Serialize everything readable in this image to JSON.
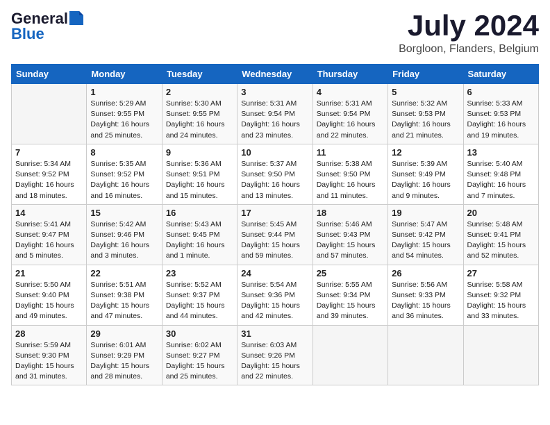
{
  "header": {
    "logo_general": "General",
    "logo_blue": "Blue",
    "title": "July 2024",
    "subtitle": "Borgloon, Flanders, Belgium"
  },
  "days_of_week": [
    "Sunday",
    "Monday",
    "Tuesday",
    "Wednesday",
    "Thursday",
    "Friday",
    "Saturday"
  ],
  "weeks": [
    [
      {
        "day": "",
        "info": ""
      },
      {
        "day": "1",
        "info": "Sunrise: 5:29 AM\nSunset: 9:55 PM\nDaylight: 16 hours\nand 25 minutes."
      },
      {
        "day": "2",
        "info": "Sunrise: 5:30 AM\nSunset: 9:55 PM\nDaylight: 16 hours\nand 24 minutes."
      },
      {
        "day": "3",
        "info": "Sunrise: 5:31 AM\nSunset: 9:54 PM\nDaylight: 16 hours\nand 23 minutes."
      },
      {
        "day": "4",
        "info": "Sunrise: 5:31 AM\nSunset: 9:54 PM\nDaylight: 16 hours\nand 22 minutes."
      },
      {
        "day": "5",
        "info": "Sunrise: 5:32 AM\nSunset: 9:53 PM\nDaylight: 16 hours\nand 21 minutes."
      },
      {
        "day": "6",
        "info": "Sunrise: 5:33 AM\nSunset: 9:53 PM\nDaylight: 16 hours\nand 19 minutes."
      }
    ],
    [
      {
        "day": "7",
        "info": "Sunrise: 5:34 AM\nSunset: 9:52 PM\nDaylight: 16 hours\nand 18 minutes."
      },
      {
        "day": "8",
        "info": "Sunrise: 5:35 AM\nSunset: 9:52 PM\nDaylight: 16 hours\nand 16 minutes."
      },
      {
        "day": "9",
        "info": "Sunrise: 5:36 AM\nSunset: 9:51 PM\nDaylight: 16 hours\nand 15 minutes."
      },
      {
        "day": "10",
        "info": "Sunrise: 5:37 AM\nSunset: 9:50 PM\nDaylight: 16 hours\nand 13 minutes."
      },
      {
        "day": "11",
        "info": "Sunrise: 5:38 AM\nSunset: 9:50 PM\nDaylight: 16 hours\nand 11 minutes."
      },
      {
        "day": "12",
        "info": "Sunrise: 5:39 AM\nSunset: 9:49 PM\nDaylight: 16 hours\nand 9 minutes."
      },
      {
        "day": "13",
        "info": "Sunrise: 5:40 AM\nSunset: 9:48 PM\nDaylight: 16 hours\nand 7 minutes."
      }
    ],
    [
      {
        "day": "14",
        "info": "Sunrise: 5:41 AM\nSunset: 9:47 PM\nDaylight: 16 hours\nand 5 minutes."
      },
      {
        "day": "15",
        "info": "Sunrise: 5:42 AM\nSunset: 9:46 PM\nDaylight: 16 hours\nand 3 minutes."
      },
      {
        "day": "16",
        "info": "Sunrise: 5:43 AM\nSunset: 9:45 PM\nDaylight: 16 hours\nand 1 minute."
      },
      {
        "day": "17",
        "info": "Sunrise: 5:45 AM\nSunset: 9:44 PM\nDaylight: 15 hours\nand 59 minutes."
      },
      {
        "day": "18",
        "info": "Sunrise: 5:46 AM\nSunset: 9:43 PM\nDaylight: 15 hours\nand 57 minutes."
      },
      {
        "day": "19",
        "info": "Sunrise: 5:47 AM\nSunset: 9:42 PM\nDaylight: 15 hours\nand 54 minutes."
      },
      {
        "day": "20",
        "info": "Sunrise: 5:48 AM\nSunset: 9:41 PM\nDaylight: 15 hours\nand 52 minutes."
      }
    ],
    [
      {
        "day": "21",
        "info": "Sunrise: 5:50 AM\nSunset: 9:40 PM\nDaylight: 15 hours\nand 49 minutes."
      },
      {
        "day": "22",
        "info": "Sunrise: 5:51 AM\nSunset: 9:38 PM\nDaylight: 15 hours\nand 47 minutes."
      },
      {
        "day": "23",
        "info": "Sunrise: 5:52 AM\nSunset: 9:37 PM\nDaylight: 15 hours\nand 44 minutes."
      },
      {
        "day": "24",
        "info": "Sunrise: 5:54 AM\nSunset: 9:36 PM\nDaylight: 15 hours\nand 42 minutes."
      },
      {
        "day": "25",
        "info": "Sunrise: 5:55 AM\nSunset: 9:34 PM\nDaylight: 15 hours\nand 39 minutes."
      },
      {
        "day": "26",
        "info": "Sunrise: 5:56 AM\nSunset: 9:33 PM\nDaylight: 15 hours\nand 36 minutes."
      },
      {
        "day": "27",
        "info": "Sunrise: 5:58 AM\nSunset: 9:32 PM\nDaylight: 15 hours\nand 33 minutes."
      }
    ],
    [
      {
        "day": "28",
        "info": "Sunrise: 5:59 AM\nSunset: 9:30 PM\nDaylight: 15 hours\nand 31 minutes."
      },
      {
        "day": "29",
        "info": "Sunrise: 6:01 AM\nSunset: 9:29 PM\nDaylight: 15 hours\nand 28 minutes."
      },
      {
        "day": "30",
        "info": "Sunrise: 6:02 AM\nSunset: 9:27 PM\nDaylight: 15 hours\nand 25 minutes."
      },
      {
        "day": "31",
        "info": "Sunrise: 6:03 AM\nSunset: 9:26 PM\nDaylight: 15 hours\nand 22 minutes."
      },
      {
        "day": "",
        "info": ""
      },
      {
        "day": "",
        "info": ""
      },
      {
        "day": "",
        "info": ""
      }
    ]
  ]
}
